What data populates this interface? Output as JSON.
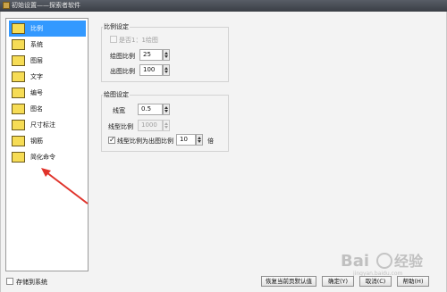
{
  "window": {
    "title": "初始设置——探索者软件"
  },
  "sidebar": {
    "items": [
      {
        "label": "比例",
        "icon": "scale-icon",
        "selected": true
      },
      {
        "label": "系统",
        "icon": "system-folder-icon",
        "selected": false
      },
      {
        "label": "图层",
        "icon": "layer-icon",
        "selected": false
      },
      {
        "label": "文字",
        "icon": "text-icon",
        "selected": false
      },
      {
        "label": "编号",
        "icon": "numbering-icon",
        "selected": false
      },
      {
        "label": "图名",
        "icon": "drawing-name-icon",
        "selected": false
      },
      {
        "label": "尺寸标注",
        "icon": "dimension-icon",
        "selected": false
      },
      {
        "label": "钢筋",
        "icon": "rebar-icon",
        "selected": false
      },
      {
        "label": "简化命令",
        "icon": "command-icon",
        "selected": false
      }
    ]
  },
  "scale_group": {
    "title": "比例设定",
    "equal_scale_label": "是否1：1绘图",
    "drawing_scale_label": "绘图比例",
    "drawing_scale_value": "25",
    "output_scale_label": "出图比例",
    "output_scale_value": "100"
  },
  "drawing_group": {
    "title": "绘图设定",
    "line_width_label": "线宽",
    "line_width_value": "0.5",
    "linetype_scale_label": "线型比例",
    "linetype_scale_value": "1000",
    "linetype_ratio_label": "线型比例为出图比例",
    "linetype_ratio_value": "10",
    "linetype_ratio_unit": "倍"
  },
  "footer": {
    "save_to_system_label": "存储到系统",
    "set_default_label": "恢复当前页默认值",
    "ok_label": "确定(Y)",
    "cancel_label": "取消(C)",
    "help_label": "帮助(H)"
  },
  "watermark": {
    "brand": "Bai",
    "brand2": "经验",
    "url": "jingyan.baidu.com"
  },
  "colors": {
    "selection": "#3399ff",
    "title_bar": "#3a3e45",
    "annotation_arrow": "#e0332b",
    "icon_fill": "#f6dc55"
  }
}
